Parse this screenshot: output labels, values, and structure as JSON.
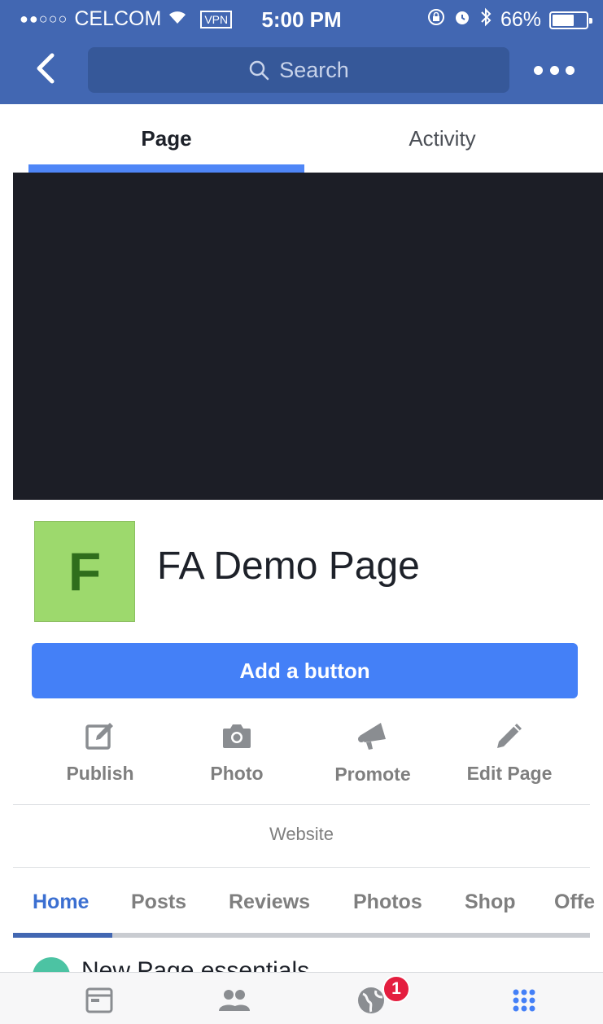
{
  "status_bar": {
    "signal": "●●○○○",
    "carrier": "CELCOM",
    "wifi": "wifi-icon",
    "vpn": "VPN",
    "time": "5:00 PM",
    "battery_text": "66%",
    "battery_level": 0.66
  },
  "nav": {
    "search_placeholder": "Search"
  },
  "top_tabs": [
    {
      "label": "Page",
      "active": true
    },
    {
      "label": "Activity",
      "active": false
    }
  ],
  "profile": {
    "avatar_letter": "F",
    "page_name": "FA Demo Page"
  },
  "add_button_label": "Add a button",
  "actions": [
    {
      "label": "Publish",
      "icon": "compose-icon"
    },
    {
      "label": "Photo",
      "icon": "camera-icon"
    },
    {
      "label": "Promote",
      "icon": "megaphone-icon"
    },
    {
      "label": "Edit Page",
      "icon": "pencil-icon"
    }
  ],
  "website_label": "Website",
  "section_tabs": [
    {
      "label": "Home",
      "active": true
    },
    {
      "label": "Posts",
      "active": false
    },
    {
      "label": "Reviews",
      "active": false
    },
    {
      "label": "Photos",
      "active": false
    },
    {
      "label": "Shop",
      "active": false
    },
    {
      "label": "Offe",
      "active": false
    }
  ],
  "essentials_title": "New Page essentials",
  "bottom_nav": {
    "items": [
      "feed-icon",
      "friends-icon",
      "globe-icon",
      "more-grid-icon"
    ],
    "notification_count": "1"
  },
  "colors": {
    "header_blue": "#4267b2",
    "accent_blue": "#4480f7",
    "avatar_green": "#9dd96d",
    "badge_red": "#e41e3f"
  }
}
